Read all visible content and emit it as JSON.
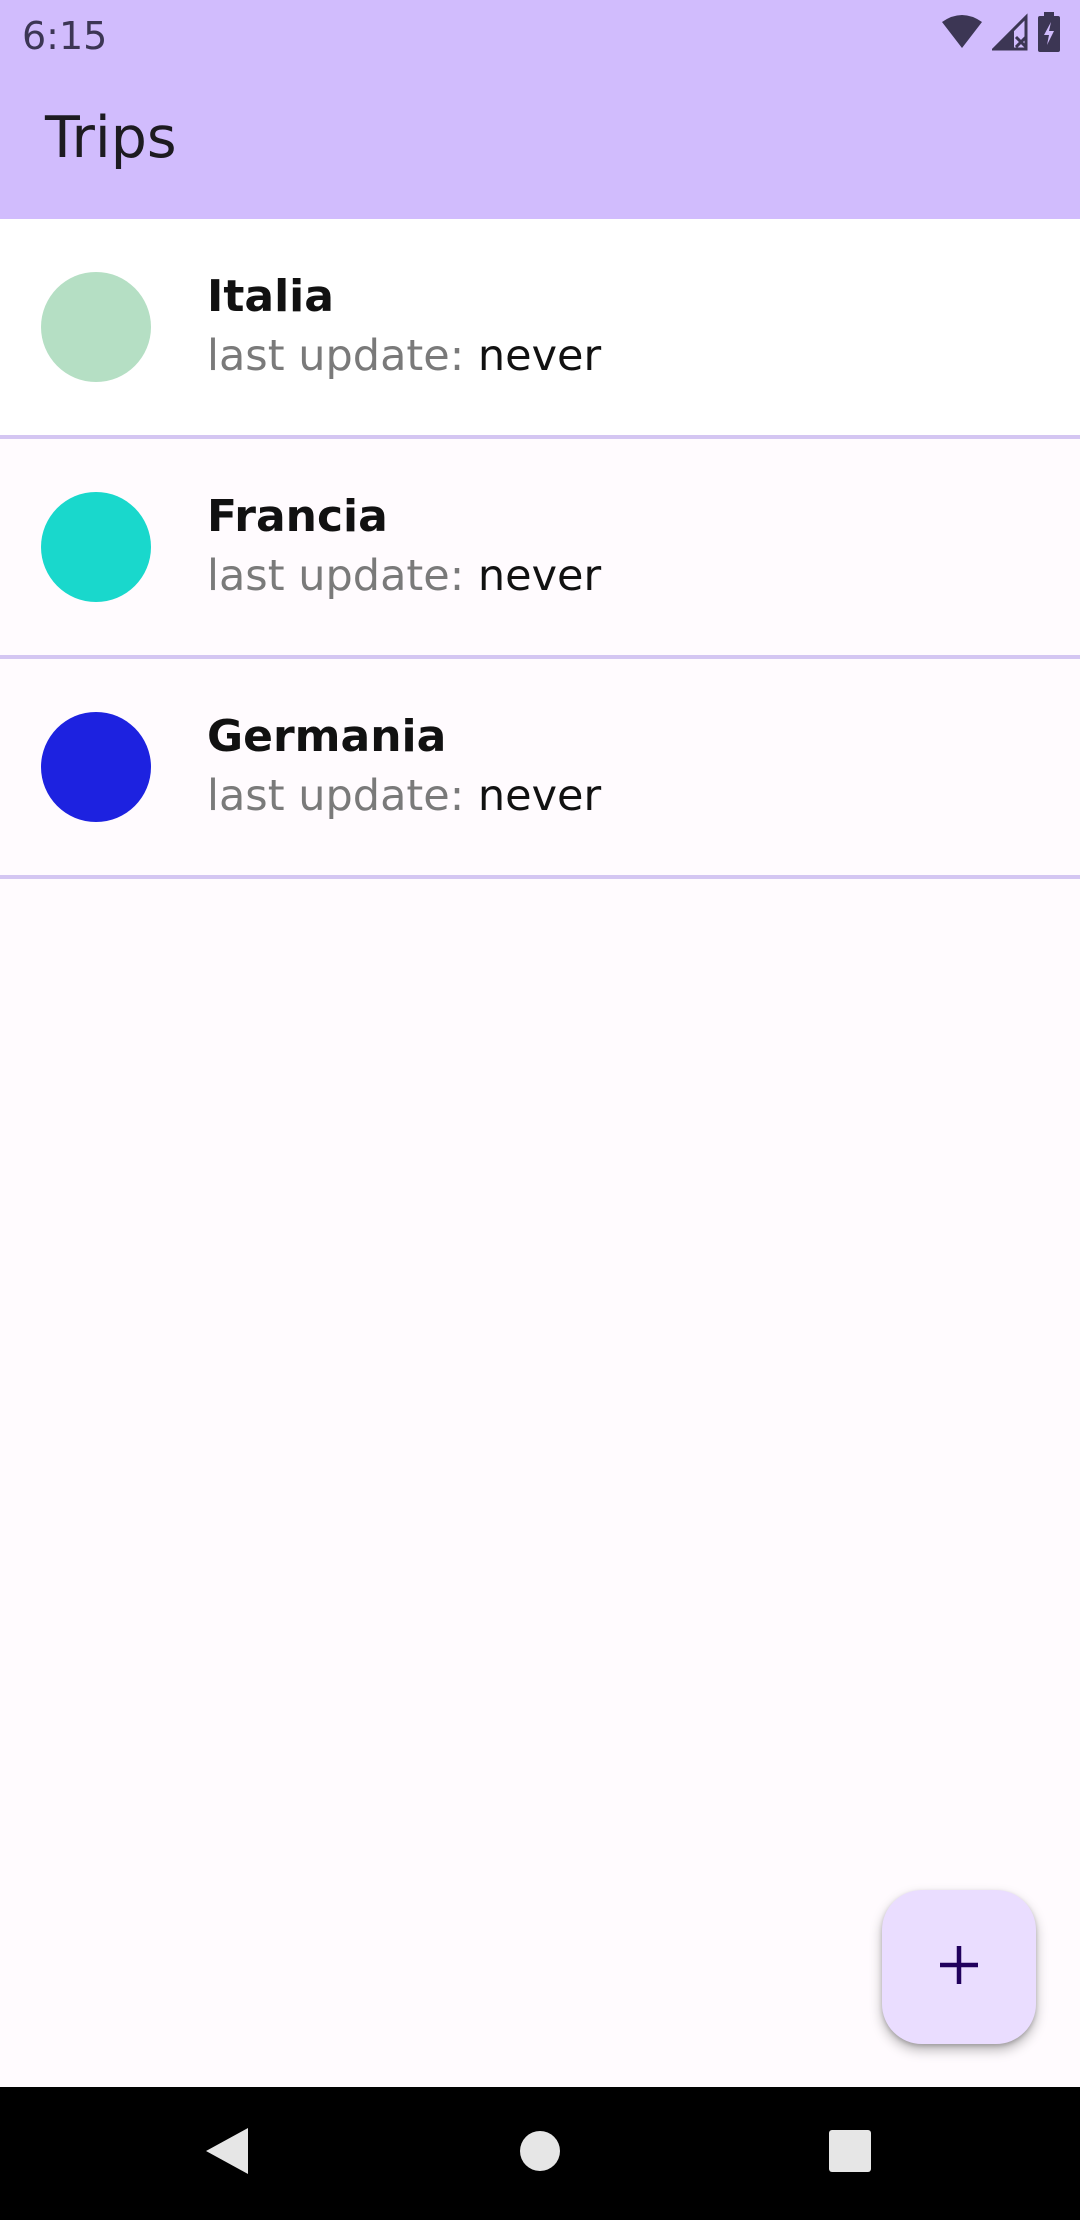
{
  "status_bar": {
    "time": "6:15",
    "icons": [
      "wifi-icon",
      "cell-signal-icon",
      "battery-charging-icon"
    ]
  },
  "app_bar": {
    "title": "Trips",
    "background": "#d1bcfd"
  },
  "trips": [
    {
      "name": "Italia",
      "update_label": "last update:",
      "update_value": "never",
      "color": "#b5dfc4"
    },
    {
      "name": "Francia",
      "update_label": "last update:",
      "update_value": "never",
      "color": "#19d8cc"
    },
    {
      "name": "Germania",
      "update_label": "last update:",
      "update_value": "never",
      "color": "#1d22e0"
    }
  ],
  "fab": {
    "icon": "plus-icon",
    "color": "#eaddff"
  },
  "nav_bar": {
    "buttons": [
      "back-icon",
      "home-icon",
      "recents-icon"
    ]
  }
}
